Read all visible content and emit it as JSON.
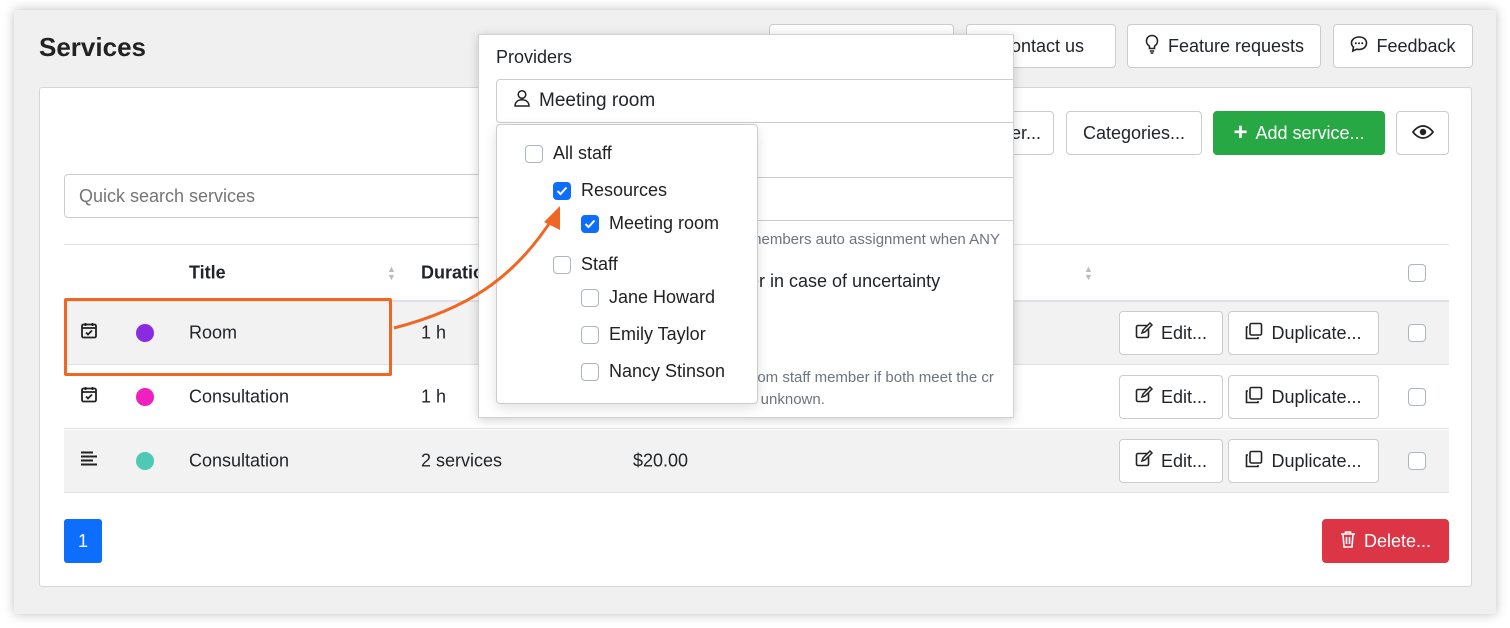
{
  "page": {
    "title": "Services"
  },
  "top_buttons": {
    "contact": "Contact us",
    "features": "Feature requests",
    "feedback": "Feedback"
  },
  "toolbar": {
    "filter_partial": "er...",
    "categories": "Categories...",
    "add_service": "Add service..."
  },
  "search": {
    "placeholder": "Quick search services"
  },
  "table": {
    "headers": {
      "title": "Title",
      "duration": "Duratio"
    },
    "rows": [
      {
        "title": "Room",
        "duration": "1 h",
        "price": "",
        "color": "#8a2be2",
        "icon": "calendar-check-icon"
      },
      {
        "title": "Consultation",
        "duration": "1 h",
        "price": "",
        "color": "#f01fc0",
        "icon": "calendar-check-icon"
      },
      {
        "title": "Consultation",
        "duration": "2 services",
        "price": "$20.00",
        "color": "#4ec9b6",
        "icon": "list-icon"
      }
    ],
    "edit_label": "Edit...",
    "duplicate_label": "Duplicate..."
  },
  "pagination": {
    "current": "1"
  },
  "delete_label": "Delete...",
  "popup": {
    "label": "Providers",
    "selected": "Meeting room",
    "bg_text_1": "members auto assignment when ANY",
    "bg_text_2": "er in case of uncertainty",
    "bg_text_3": "dom staff member if both meet the cr",
    "bg_text_4": "s unknown.",
    "options": [
      {
        "label": "All staff",
        "checked": false
      },
      {
        "label": "Resources",
        "checked": true
      },
      {
        "label": "Meeting room",
        "checked": true
      },
      {
        "label": "Staff",
        "checked": false
      },
      {
        "label": "Jane Howard",
        "checked": false
      },
      {
        "label": "Emily Taylor",
        "checked": false
      },
      {
        "label": "Nancy Stinson",
        "checked": false
      }
    ]
  },
  "colors": {
    "accent": "#0d6efd",
    "green": "#28a745",
    "red": "#dc3545",
    "highlight": "#f06623"
  }
}
